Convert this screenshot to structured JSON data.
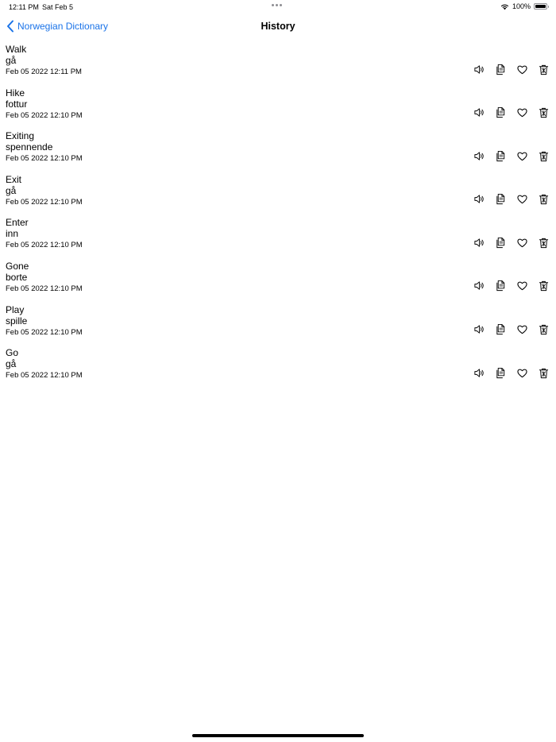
{
  "status_bar": {
    "time": "12:11 PM",
    "date": "Sat Feb 5",
    "battery": "100%"
  },
  "nav": {
    "back_label": "Norwegian Dictionary",
    "title": "History"
  },
  "colors": {
    "accent": "#1a73e8",
    "text": "#000000",
    "background": "#ffffff"
  },
  "history": [
    {
      "word": "Walk",
      "translation": "gå",
      "timestamp": "Feb 05 2022 12:11 PM"
    },
    {
      "word": "Hike",
      "translation": "fottur",
      "timestamp": "Feb 05 2022 12:10 PM"
    },
    {
      "word": "Exiting",
      "translation": "spennende",
      "timestamp": "Feb 05 2022 12:10 PM"
    },
    {
      "word": "Exit",
      "translation": "gå",
      "timestamp": "Feb 05 2022 12:10 PM"
    },
    {
      "word": "Enter",
      "translation": "inn",
      "timestamp": "Feb 05 2022 12:10 PM"
    },
    {
      "word": "Gone",
      "translation": "borte",
      "timestamp": "Feb 05 2022 12:10 PM"
    },
    {
      "word": "Play",
      "translation": "spille",
      "timestamp": "Feb 05 2022 12:10 PM"
    },
    {
      "word": "Go",
      "translation": "gå",
      "timestamp": "Feb 05 2022 12:10 PM"
    }
  ],
  "row_icons": [
    "speaker-icon",
    "copy-icon",
    "heart-icon",
    "trash-icon"
  ]
}
